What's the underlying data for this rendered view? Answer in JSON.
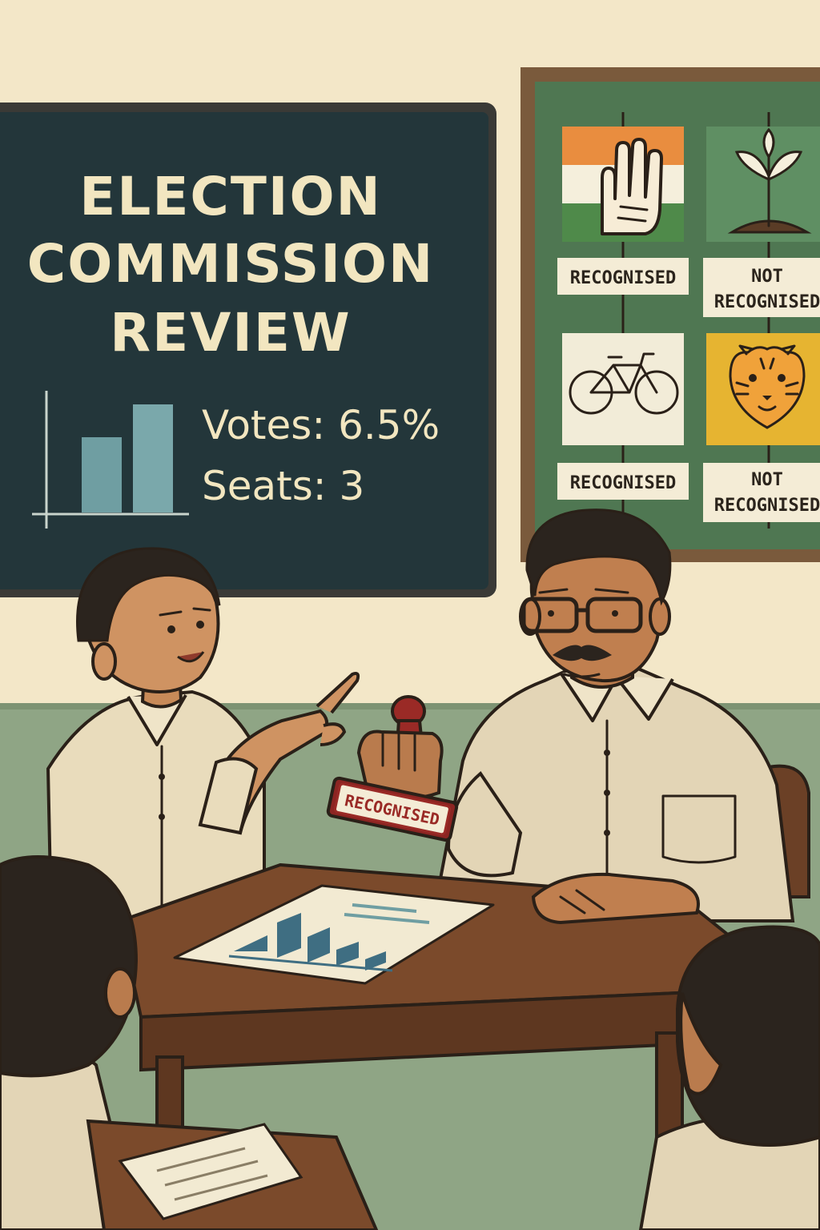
{
  "screen": {
    "title_lines": [
      "ELECTION",
      "COMMISSION",
      "REVIEW"
    ],
    "votes_text": "Votes: 6.5%",
    "seats_text": "Seats: 3",
    "mini_chart_values": [
      0.6,
      0.85
    ]
  },
  "board": {
    "cards": [
      {
        "symbol": "hand-icon",
        "label_lines": [
          "RECOGNISED"
        ]
      },
      {
        "symbol": "sprout-icon",
        "label_lines": [
          "NOT",
          "RECOGNISED"
        ]
      },
      {
        "symbol": "bicycle-icon",
        "label_lines": [
          "RECOGNISED"
        ]
      },
      {
        "symbol": "tiger-icon",
        "label_lines": [
          "NOT",
          "RECOGNISED"
        ]
      }
    ]
  },
  "stamp": {
    "text": "RECOGNISED"
  },
  "colors": {
    "wall": "#f3e7c8",
    "wainscot": "#8fa585",
    "chalkboard": "#23363a",
    "corkboard": "#4f7752",
    "desk": "#7b4a2b",
    "stamp_red": "#9a2a26",
    "saffron": "#e98d3f",
    "india_green": "#4f8a4a"
  }
}
